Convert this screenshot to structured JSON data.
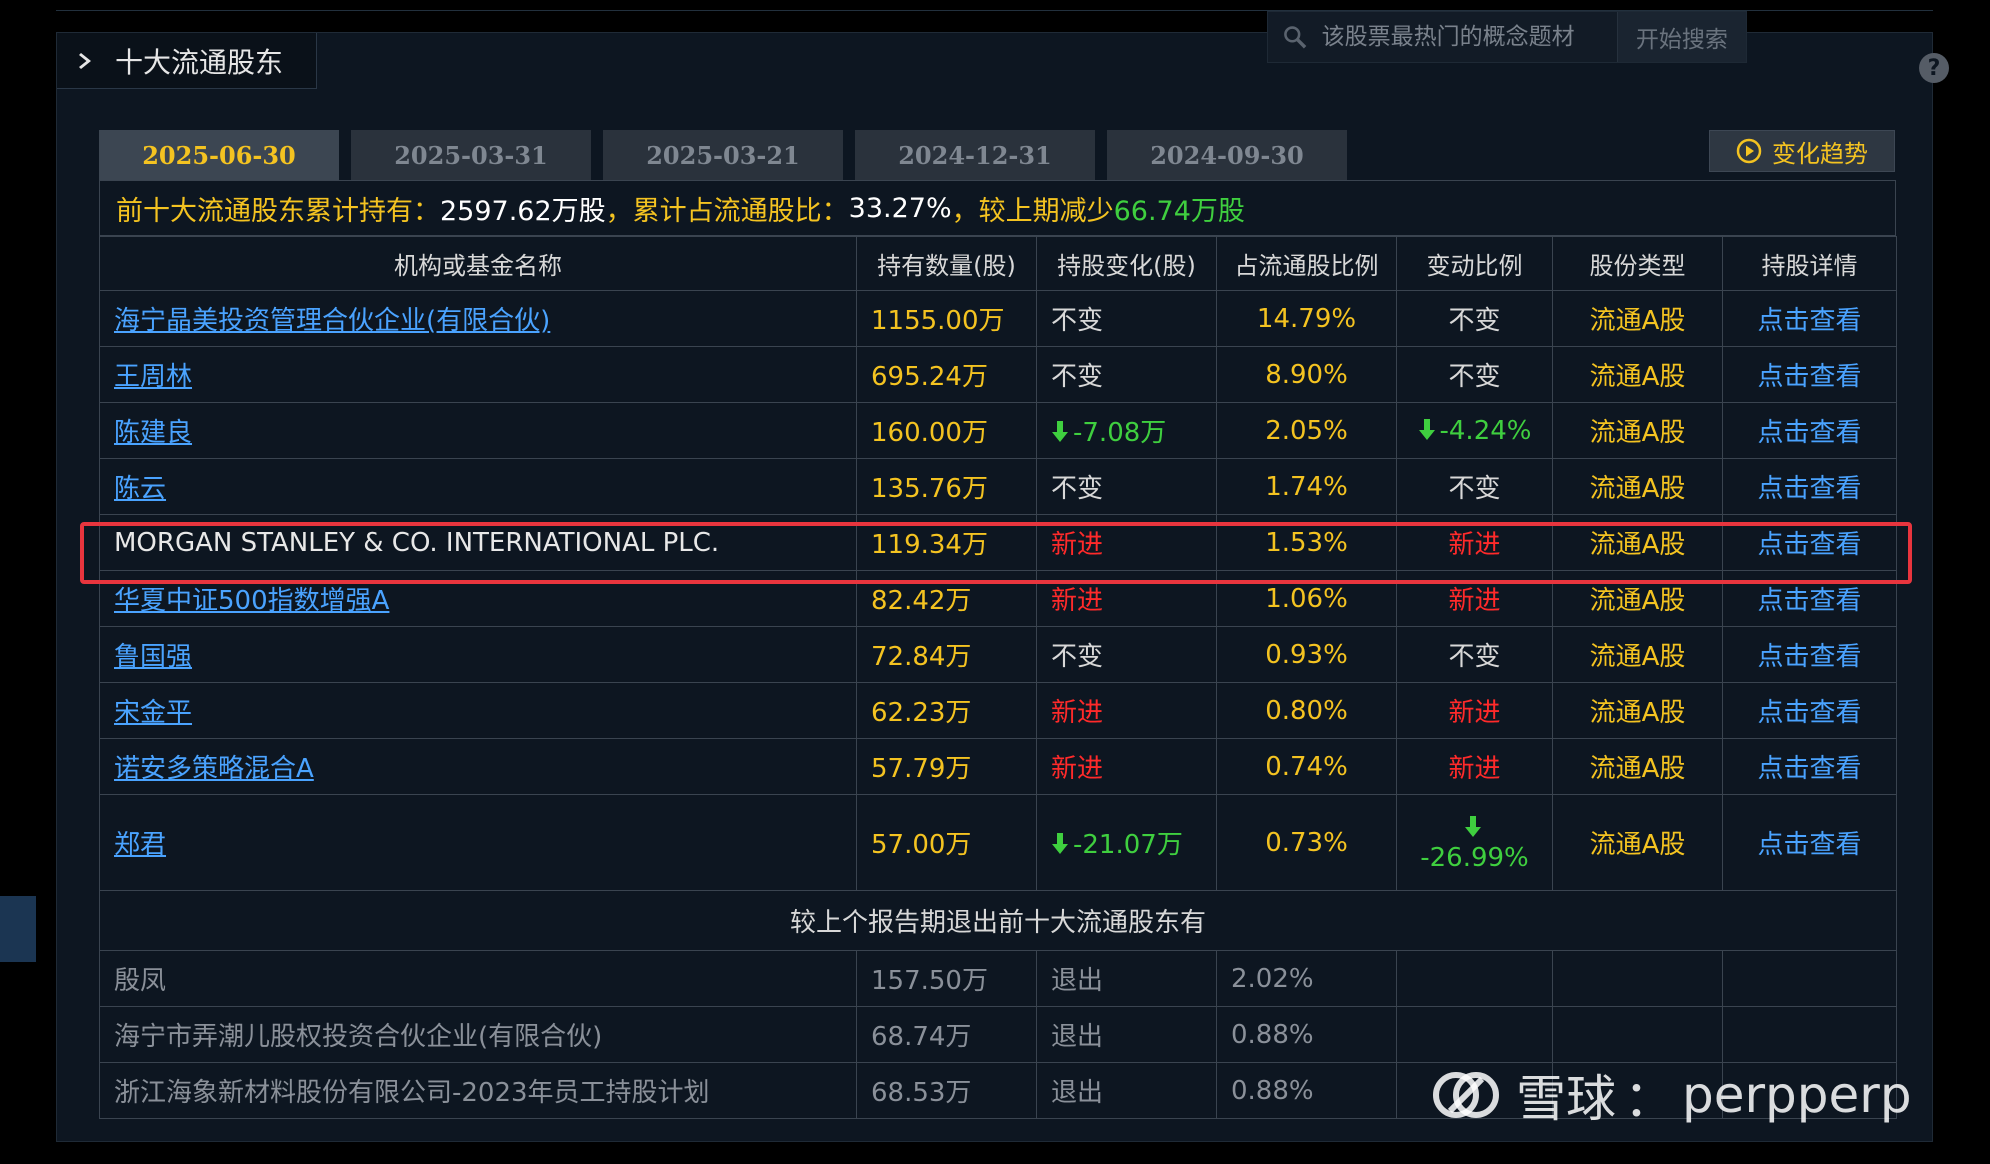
{
  "section_title": "十大流通股东",
  "search": {
    "placeholder": "该股票最热门的概念题材",
    "button": "开始搜索"
  },
  "help_label": "?",
  "tabs": [
    {
      "label": "2025-06-30",
      "active": true
    },
    {
      "label": "2025-03-31",
      "active": false
    },
    {
      "label": "2025-03-21",
      "active": false
    },
    {
      "label": "2024-12-31",
      "active": false
    },
    {
      "label": "2024-09-30",
      "active": false
    }
  ],
  "trend_button": "变化趋势",
  "summary": {
    "p1": "前十大流通股东累计持有：",
    "total": "2597.62万股",
    "p2": "，累计占流通股比：",
    "ratio": "33.27%",
    "p3": " ，较上期减少",
    "change": "66.74万股"
  },
  "columns": [
    "机构或基金名称",
    "持有数量(股)",
    "持股变化(股)",
    "占流通股比例",
    "变动比例",
    "股份类型",
    "持股详情"
  ],
  "rows": [
    {
      "name": "海宁晶美投资管理合伙企业(有限合伙)",
      "link": true,
      "hold": "1155.00万",
      "change": "不变",
      "change_type": "same",
      "ratio": "14.79%",
      "var": "不变",
      "var_type": "same",
      "type": "流通A股",
      "detail": "点击查看"
    },
    {
      "name": "王周林",
      "link": true,
      "hold": "695.24万",
      "change": "不变",
      "change_type": "same",
      "ratio": "8.90%",
      "var": "不变",
      "var_type": "same",
      "type": "流通A股",
      "detail": "点击查看"
    },
    {
      "name": "陈建良",
      "link": true,
      "hold": "160.00万",
      "change": "-7.08万",
      "change_type": "down",
      "ratio": "2.05%",
      "var": "-4.24%",
      "var_type": "down",
      "type": "流通A股",
      "detail": "点击查看"
    },
    {
      "name": "陈云",
      "link": true,
      "hold": "135.76万",
      "change": "不变",
      "change_type": "same",
      "ratio": "1.74%",
      "var": "不变",
      "var_type": "same",
      "type": "流通A股",
      "detail": "点击查看"
    },
    {
      "name": "MORGAN STANLEY & CO. INTERNATIONAL PLC.",
      "link": false,
      "hold": "119.34万",
      "change": "新进",
      "change_type": "new",
      "ratio": "1.53%",
      "var": "新进",
      "var_type": "new",
      "type": "流通A股",
      "detail": "点击查看"
    },
    {
      "name": "华夏中证500指数增强A",
      "link": true,
      "hold": "82.42万",
      "change": "新进",
      "change_type": "new",
      "ratio": "1.06%",
      "var": "新进",
      "var_type": "new",
      "type": "流通A股",
      "detail": "点击查看"
    },
    {
      "name": "鲁国强",
      "link": true,
      "hold": "72.84万",
      "change": "不变",
      "change_type": "same",
      "ratio": "0.93%",
      "var": "不变",
      "var_type": "same",
      "type": "流通A股",
      "detail": "点击查看"
    },
    {
      "name": "宋金平",
      "link": true,
      "hold": "62.23万",
      "change": "新进",
      "change_type": "new",
      "ratio": "0.80%",
      "var": "新进",
      "var_type": "new",
      "type": "流通A股",
      "detail": "点击查看"
    },
    {
      "name": "诺安多策略混合A",
      "link": true,
      "hold": "57.79万",
      "change": "新进",
      "change_type": "new",
      "ratio": "0.74%",
      "var": "新进",
      "var_type": "new",
      "type": "流通A股",
      "detail": "点击查看"
    },
    {
      "name": "郑君",
      "link": true,
      "hold": "57.00万",
      "change": "-21.07万",
      "change_type": "down",
      "ratio": "0.73%",
      "var": "-26.99%",
      "var_type": "down",
      "type": "流通A股",
      "detail": "点击查看"
    }
  ],
  "exit_title": "较上个报告期退出前十大流通股东有",
  "exit_rows": [
    {
      "name": "殷凤",
      "hold": "157.50万",
      "status": "退出",
      "ratio": "2.02%"
    },
    {
      "name": "海宁市弄潮儿股权投资合伙企业(有限合伙)",
      "hold": "68.74万",
      "status": "退出",
      "ratio": "0.88%"
    },
    {
      "name": "浙江海象新材料股份有限公司-2023年员工持股计划",
      "hold": "68.53万",
      "status": "退出",
      "ratio": "0.88%"
    }
  ],
  "watermark": {
    "brand": "雪球",
    "sep": "：",
    "user": "perpperp"
  },
  "colors": {
    "accent": "#f4c321",
    "link": "#4aa3ff",
    "new": "#ff2a2a",
    "down": "#3fcf3f",
    "highlight": "#e8353e"
  }
}
